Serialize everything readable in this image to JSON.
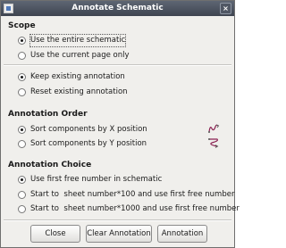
{
  "window": {
    "title": "Annotate Schematic",
    "close_glyph": "×"
  },
  "scope": {
    "heading": "Scope",
    "options": [
      {
        "label": "Use the entire schematic",
        "selected": true
      },
      {
        "label": "Use the current page only",
        "selected": false
      },
      {
        "label": "Keep existing annotation",
        "selected": true
      },
      {
        "label": "Reset existing annotation",
        "selected": false
      }
    ]
  },
  "order": {
    "heading": "Annotation Order",
    "options": [
      {
        "label": "Sort components by X position",
        "selected": true,
        "icon": "sort-x-icon"
      },
      {
        "label": "Sort components by Y position",
        "selected": false,
        "icon": "sort-y-icon"
      }
    ]
  },
  "choice": {
    "heading": "Annotation Choice",
    "options": [
      {
        "label": "Use first free number in schematic",
        "selected": true
      },
      {
        "label": "Start to  sheet number*100 and use first free number",
        "selected": false
      },
      {
        "label": "Start to  sheet number*1000 and use first free number",
        "selected": false
      }
    ]
  },
  "buttons": {
    "close": "Close",
    "clear": "Clear Annotation",
    "annotate": "Annotation"
  },
  "colors": {
    "titlebar": "#4a505b",
    "dialog_bg": "#f0efec",
    "accent_icon": "#8b2252"
  }
}
